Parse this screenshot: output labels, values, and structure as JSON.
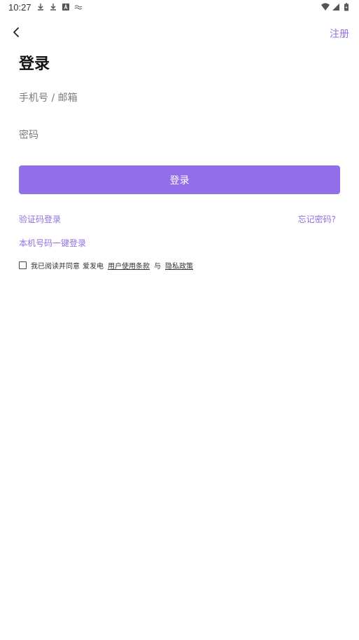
{
  "status_bar": {
    "time": "10:27",
    "left_icons": [
      "download-icon",
      "download-icon",
      "a-badge-icon",
      "signal-wave-icon"
    ],
    "right_icons": [
      "wifi-icon",
      "cell-signal-icon",
      "battery-icon"
    ]
  },
  "nav": {
    "back_icon": "chevron-left-icon",
    "register_label": "注册"
  },
  "title": "登录",
  "form": {
    "account_placeholder": "手机号 / 邮箱",
    "account_value": "",
    "password_placeholder": "密码",
    "password_value": "",
    "submit_label": "登录"
  },
  "links": {
    "sms_login": "验证码登录",
    "forgot_password": "忘记密码?",
    "onekey_login": "本机号码一键登录"
  },
  "agreement": {
    "checked": false,
    "prefix": "我已阅读并同意",
    "app_name": "爱发电",
    "terms": "用户使用条款",
    "and": "与",
    "privacy": "隐私政策"
  },
  "colors": {
    "accent": "#936eea",
    "link": "#9170e0",
    "text": "#111111",
    "placeholder": "#7a7a7a"
  }
}
